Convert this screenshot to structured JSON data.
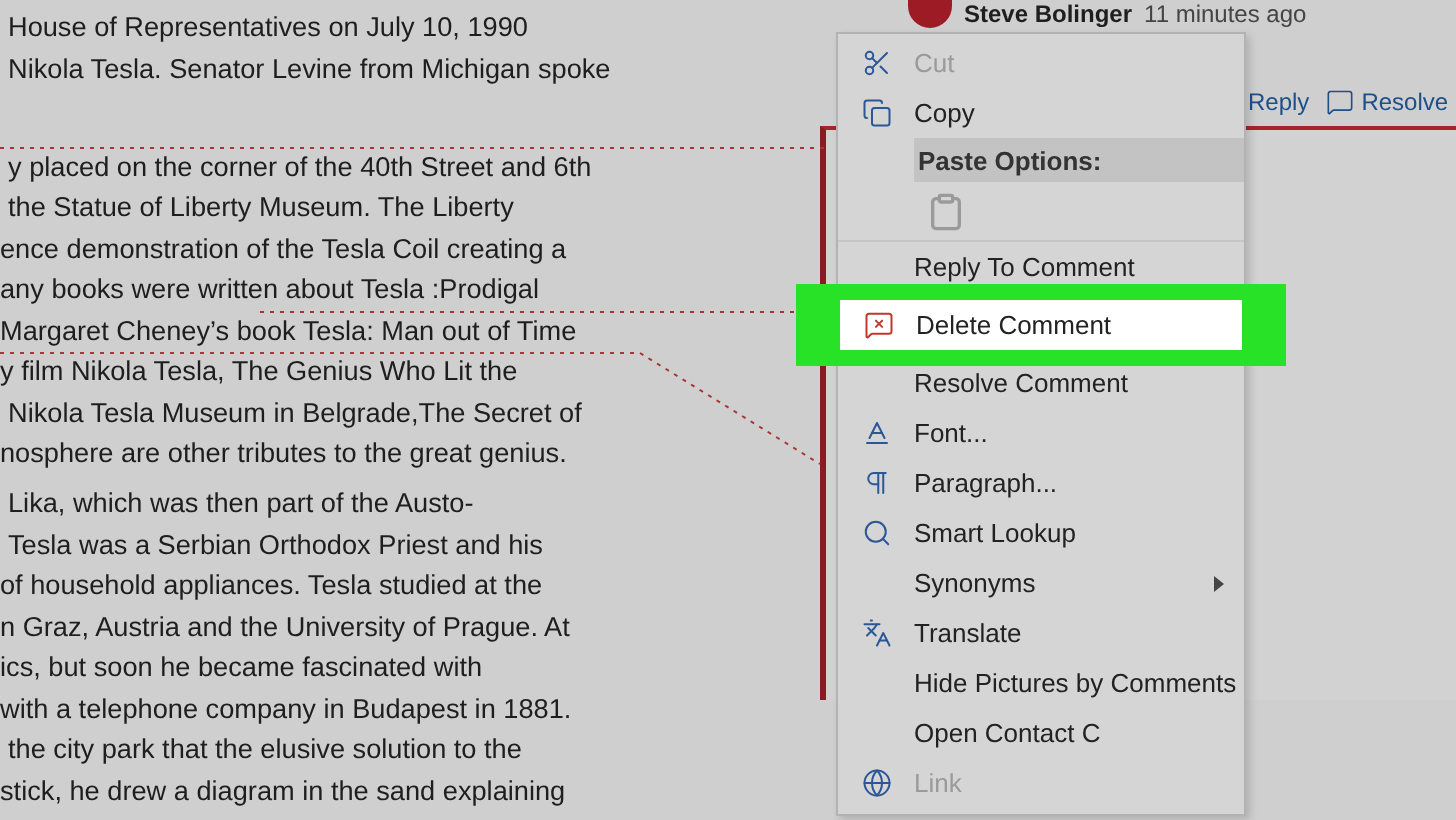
{
  "document": {
    "paragraphs": [
      {
        "lines": [
          "House of Representatives on July 10, 1990",
          "Nikola Tesla. Senator Levine from Michigan spoke"
        ]
      },
      {
        "lines": [
          "y placed on the corner of the 40th Street and 6th",
          "the Statue of Liberty Museum. The Liberty",
          "ence demonstration of the Tesla Coil creating a",
          "any books were written about Tesla :Prodigal",
          "Margaret Cheney’s book Tesla: Man out of Time",
          "y film Nikola Tesla, The Genius Who Lit the",
          "Nikola Tesla Museum in Belgrade,The Secret of",
          "nosphere are other tributes to the great genius."
        ]
      },
      {
        "lines": [
          "Lika, which was then part of  the Austo-",
          "Tesla was a Serbian Orthodox Priest and his",
          "of household appliances. Tesla studied at the",
          "n Graz, Austria and the University of Prague. At",
          "ics, but soon he became fascinated with",
          "with a telephone company in Budapest in 1881.",
          "the city park that the elusive solution to the",
          "stick, he drew a diagram in the sand explaining"
        ]
      }
    ]
  },
  "comment": {
    "author": "Steve Bolinger",
    "time": "11 minutes ago",
    "actions": [
      "Reply",
      "Resolve"
    ]
  },
  "context_menu": {
    "items": [
      {
        "kind": "item",
        "label": "Cut",
        "disabled": true,
        "highlighted": false
      },
      {
        "kind": "item",
        "label": "Copy",
        "disabled": false,
        "highlighted": false
      },
      {
        "kind": "header",
        "label": "Paste Options:"
      },
      {
        "kind": "paste-icons"
      },
      {
        "kind": "item",
        "label": "Reply To Comment",
        "disabled": false,
        "highlighted": false
      },
      {
        "kind": "item",
        "label": "Delete Comment",
        "disabled": false,
        "highlighted": true
      },
      {
        "kind": "item",
        "label": "Resolve Comment",
        "disabled": false,
        "highlighted": false
      },
      {
        "kind": "item",
        "label": "Font...",
        "disabled": false,
        "highlighted": false
      },
      {
        "kind": "item",
        "label": "Paragraph...",
        "disabled": false,
        "highlighted": false
      },
      {
        "kind": "item",
        "label": "Smart Lookup",
        "disabled": false,
        "highlighted": false
      },
      {
        "kind": "submenu",
        "label": "Synonyms",
        "disabled": false,
        "highlighted": false
      },
      {
        "kind": "item",
        "label": "Translate",
        "disabled": false,
        "highlighted": false
      },
      {
        "kind": "item",
        "label": "Hide Pictures by Comments",
        "disabled": false,
        "highlighted": false
      },
      {
        "kind": "item",
        "label": "Open Contact C",
        "disabled": false,
        "highlighted": false
      },
      {
        "kind": "item",
        "label": "Link",
        "disabled": true,
        "highlighted": false
      }
    ]
  }
}
